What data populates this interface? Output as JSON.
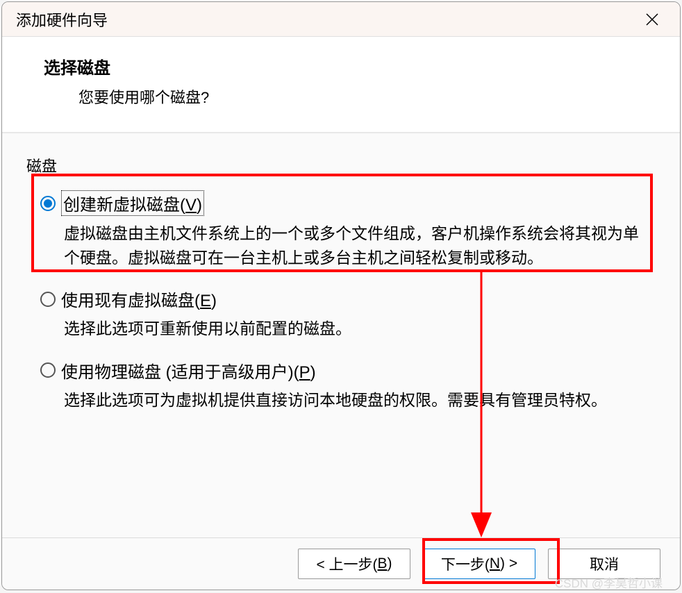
{
  "window": {
    "title": "添加硬件向导"
  },
  "header": {
    "title": "选择磁盘",
    "subtitle": "您要使用哪个磁盘?"
  },
  "group": {
    "label": "磁盘"
  },
  "options": [
    {
      "label_prefix": "创建新虚拟磁盘(",
      "label_key": "V",
      "label_suffix": ")",
      "description": "虚拟磁盘由主机文件系统上的一个或多个文件组成，客户机操作系统会将其视为单个硬盘。虚拟磁盘可在一台主机上或多台主机之间轻松复制或移动。",
      "checked": true
    },
    {
      "label_prefix": "使用现有虚拟磁盘(",
      "label_key": "E",
      "label_suffix": ")",
      "description": "选择此选项可重新使用以前配置的磁盘。",
      "checked": false
    },
    {
      "label_prefix": "使用物理磁盘 (适用于高级用户)(",
      "label_key": "P",
      "label_suffix": ")",
      "description": "选择此选项可为虚拟机提供直接访问本地硬盘的权限。需要具有管理员特权。",
      "checked": false
    }
  ],
  "buttons": {
    "back_prefix": "< 上一步(",
    "back_key": "B",
    "back_suffix": ")",
    "next_prefix": "下一步(",
    "next_key": "N",
    "next_suffix": ") >",
    "cancel": "取消"
  },
  "watermark": "CSDN @李昊哲小课"
}
